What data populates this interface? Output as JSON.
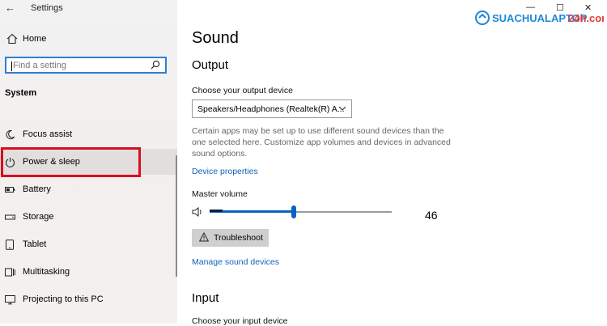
{
  "window": {
    "title": "Settings"
  },
  "sidebar": {
    "home_label": "Home",
    "search_placeholder": "Find a setting",
    "section_title": "System",
    "items": [
      {
        "label": "Focus assist",
        "icon": "moon-icon"
      },
      {
        "label": "Power & sleep",
        "icon": "power-icon",
        "selected": true
      },
      {
        "label": "Battery",
        "icon": "battery-icon"
      },
      {
        "label": "Storage",
        "icon": "storage-icon"
      },
      {
        "label": "Tablet",
        "icon": "tablet-icon"
      },
      {
        "label": "Multitasking",
        "icon": "multitasking-icon"
      },
      {
        "label": "Projecting to this PC",
        "icon": "projecting-icon"
      }
    ]
  },
  "watermark": {
    "text_main": "SUACHUALAPTOP",
    "text_accent": "24h.com"
  },
  "main": {
    "title": "Sound",
    "output": {
      "heading": "Output",
      "device_label": "Choose your output device",
      "device_value": "Speakers/Headphones (Realtek(R) A...",
      "description": "Certain apps may be set up to use different sound devices than the one selected here. Customize app volumes and devices in advanced sound options.",
      "device_properties_link": "Device properties",
      "volume_label": "Master volume",
      "volume_value": "46",
      "volume_level": 46,
      "troubleshoot_label": "Troubleshoot",
      "manage_link": "Manage sound devices"
    },
    "input": {
      "heading": "Input",
      "device_label": "Choose your input device"
    }
  },
  "colors": {
    "accent": "#0a63c4",
    "highlight_box": "#d80f1f",
    "link": "#1063b8"
  }
}
